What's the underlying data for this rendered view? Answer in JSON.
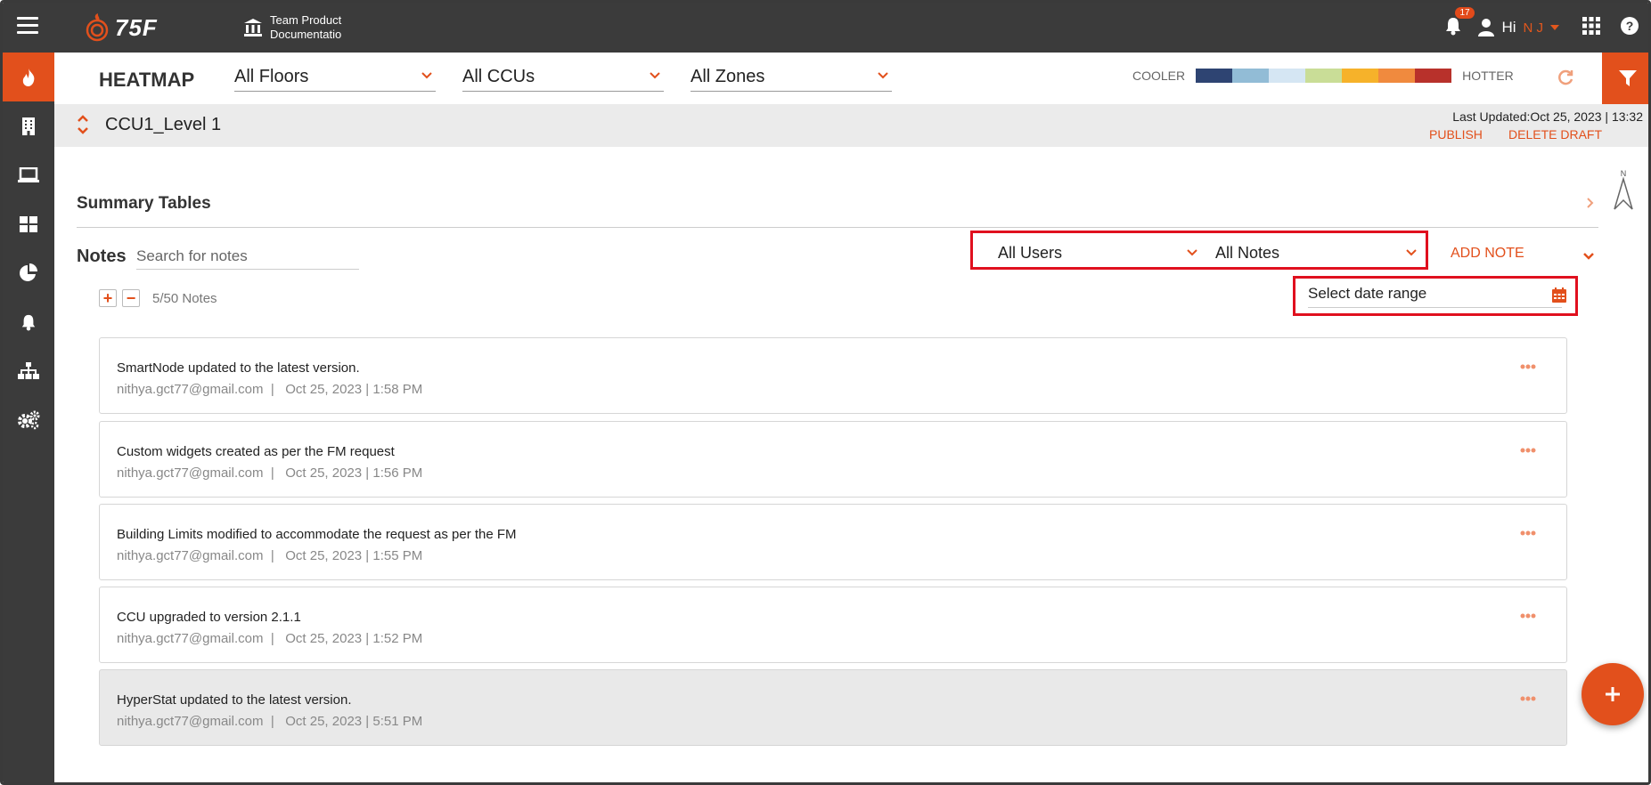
{
  "app": {
    "brand": "75F",
    "site_line1": "Team Product",
    "site_line2": "Documentatio",
    "notification_count": "17",
    "greeting": "Hi",
    "user_initials": "N J",
    "accent_color": "#e2501c"
  },
  "sidebar": {
    "items": [
      {
        "icon": "flame-icon",
        "active": true
      },
      {
        "icon": "building-icon"
      },
      {
        "icon": "laptop-icon"
      },
      {
        "icon": "dashboard-grid-icon"
      },
      {
        "icon": "pie-chart-icon"
      },
      {
        "icon": "bell-icon"
      },
      {
        "icon": "hierarchy-icon"
      },
      {
        "icon": "gears-icon"
      }
    ]
  },
  "header": {
    "title": "HEATMAP",
    "floors": "All Floors",
    "ccus": "All CCUs",
    "zones": "All Zones",
    "legend_cooler": "COOLER",
    "legend_hotter": "HOTTER",
    "legend_colors": [
      "#2e4472",
      "#92bcd6",
      "#d5e6f3",
      "#c9dd97",
      "#f6b22a",
      "#f08a3e",
      "#b8312b"
    ]
  },
  "ccu": {
    "name": "CCU1_Level 1",
    "last_updated": "Last Updated:Oct 25, 2023 | 13:32",
    "publish": "PUBLISH",
    "delete_draft": "DELETE DRAFT"
  },
  "summary": {
    "title": "Summary Tables"
  },
  "notes": {
    "label": "Notes",
    "search_placeholder": "Search for notes",
    "users_filter": "All Users",
    "notes_filter": "All Notes",
    "add_note": "ADD NOTE",
    "date_range": "Select date range",
    "count": "5/50 Notes",
    "items": [
      {
        "title": "SmartNode updated to the latest version.",
        "author": "nithya.gct77@gmail.com",
        "sep": "|",
        "time": "Oct 25, 2023 | 1:58 PM"
      },
      {
        "title": "Custom widgets created as per the FM request",
        "author": "nithya.gct77@gmail.com",
        "sep": "|",
        "time": "Oct 25, 2023 | 1:56 PM"
      },
      {
        "title": "Building Limits modified to accommodate the request as per the FM",
        "author": "nithya.gct77@gmail.com",
        "sep": "|",
        "time": "Oct 25, 2023 | 1:55 PM"
      },
      {
        "title": "CCU upgraded to version 2.1.1",
        "author": "nithya.gct77@gmail.com",
        "sep": "|",
        "time": "Oct 25, 2023 | 1:52 PM"
      },
      {
        "title": "HyperStat updated to the latest version.",
        "author": "nithya.gct77@gmail.com",
        "sep": "|",
        "time": "Oct 25, 2023 | 5:51 PM"
      }
    ]
  }
}
